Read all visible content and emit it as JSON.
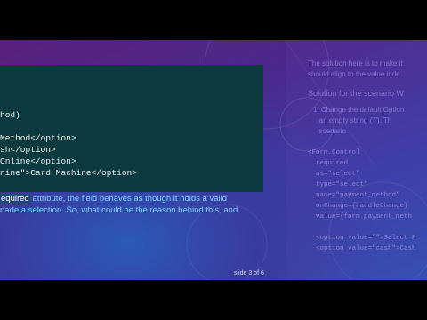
{
  "slide": {
    "code_lines": [
      "hod)",
      "Method</option>",
      "sh</option>",
      "Online</option>",
      "nine\">Card Machine</option>"
    ],
    "body": {
      "highlight": "equired",
      "line1_rest": " attribute, the field behaves as though it holds a valid",
      "line2": "nade a selection. So, what could be the reason behind this, and"
    },
    "slide_number": "slide 3 of 6"
  },
  "faded_next_slide": {
    "lines": [
      "The solution here is to make it",
      "should align to the value inde",
      "Solution for the scenario W",
      "1. Change the default Option",
      "   an empty string (\"\"). Th",
      "   scenario.",
      "<Form.Control",
      "  required",
      "  as=\"select\"",
      "  type=\"select\"",
      "  name=\"payment_method\"",
      "  onChange={handleChange}",
      "  value={form.payment_meth",
      "  <option value=\"\">Select P",
      "  <option value=\"cash\">Cash"
    ]
  },
  "colors": {
    "code_bg": "#0d3a3e",
    "body_text": "#7fd0ff",
    "highlight_bg": "#1e4b6e"
  }
}
